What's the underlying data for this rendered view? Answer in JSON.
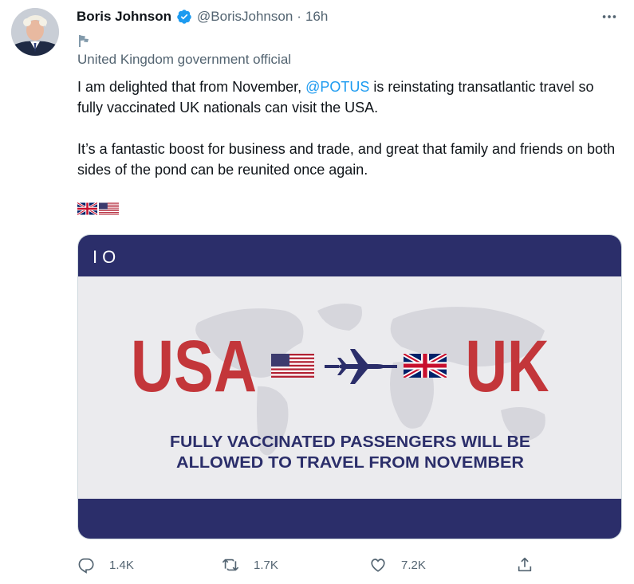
{
  "tweet": {
    "author_name": "Boris Johnson",
    "handle": "@BorisJohnson",
    "separator": "·",
    "time": "16h",
    "label": "United Kingdom government official",
    "text_before_mention": "I am delighted that from November, ",
    "mention": "@POTUS",
    "text_after_mention": " is reinstating transatlantic travel so fully vaccinated UK nationals can visit the USA.",
    "paragraph2": "It’s a fantastic boost for business and trade, and great that family and friends on both sides of the pond can be reunited once again.",
    "emojis": [
      "uk-flag",
      "us-flag"
    ],
    "accent_color": "#1d9bf0"
  },
  "image": {
    "corner_text": "IO",
    "left_word": "USA",
    "right_word": "UK",
    "subtitle_line1": "FULLY VACCINATED PASSENGERS WILL BE",
    "subtitle_line2": "ALLOWED TO TRAVEL FROM NOVEMBER",
    "band_color": "#2b2e6a",
    "word_color": "#c3363a"
  },
  "actions": {
    "reply_count": "1.4K",
    "retweet_count": "1.7K",
    "like_count": "7.2K"
  }
}
